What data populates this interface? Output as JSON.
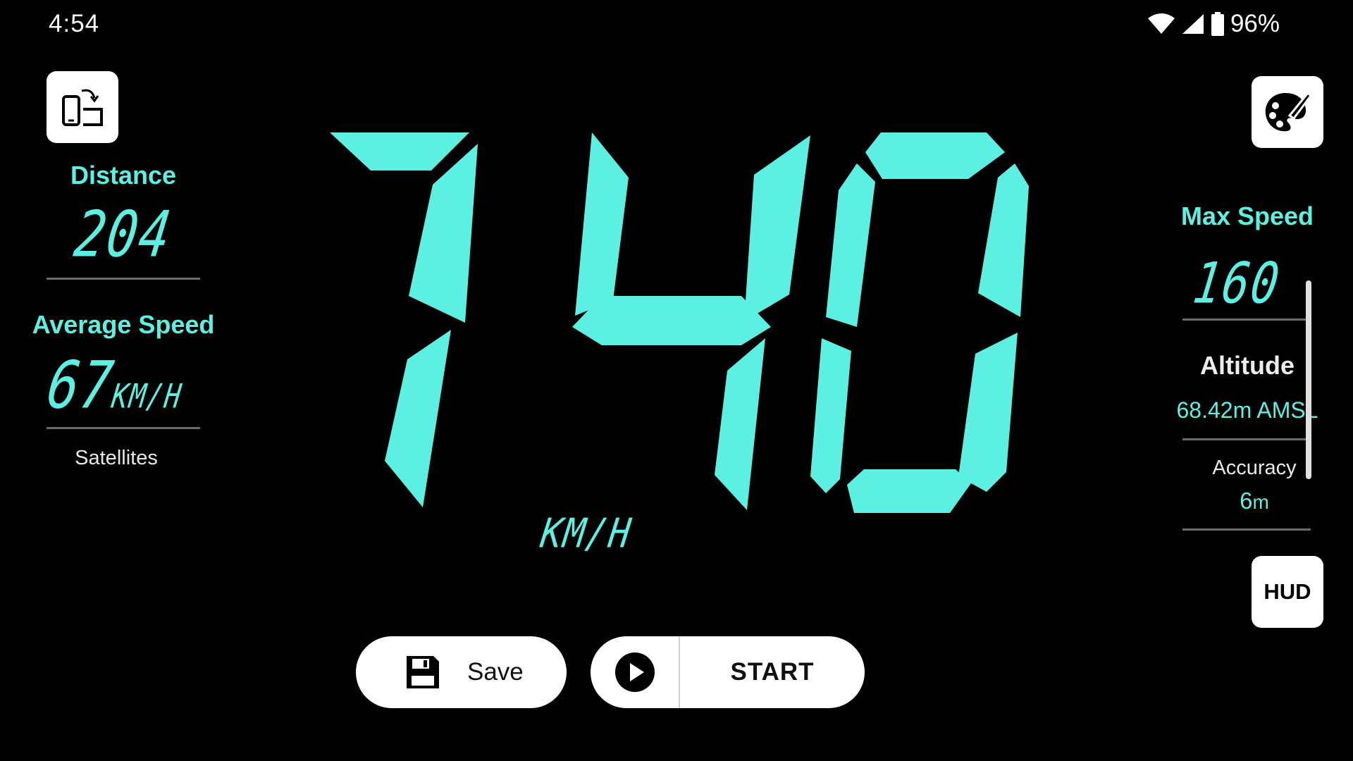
{
  "status_bar": {
    "time": "4:54",
    "battery": "96%",
    "icons": [
      "wifi-icon",
      "signal-icon",
      "battery-icon"
    ]
  },
  "left_panel": {
    "rotate_button_icon": "screen-rotate-icon",
    "distance_label": "Distance",
    "distance_value": "204",
    "average_speed_label": "Average Speed",
    "average_speed_value": "67",
    "average_speed_unit": "KM/H",
    "satellites_label": "Satellites"
  },
  "speedometer": {
    "speed": "140",
    "unit": "KM/H",
    "color": "#5cf0e2"
  },
  "right_panel": {
    "theme_button_icon": "palette-icon",
    "max_speed_label": "Max Speed",
    "max_speed_value": "160",
    "altitude_label": "Altitude",
    "altitude_value": "68.42m AMSL",
    "accuracy_label": "Accuracy",
    "accuracy_value": "6",
    "accuracy_unit": "m",
    "hud_button_label": "HUD"
  },
  "bottom_bar": {
    "save_label": "Save",
    "start_label": "START"
  }
}
